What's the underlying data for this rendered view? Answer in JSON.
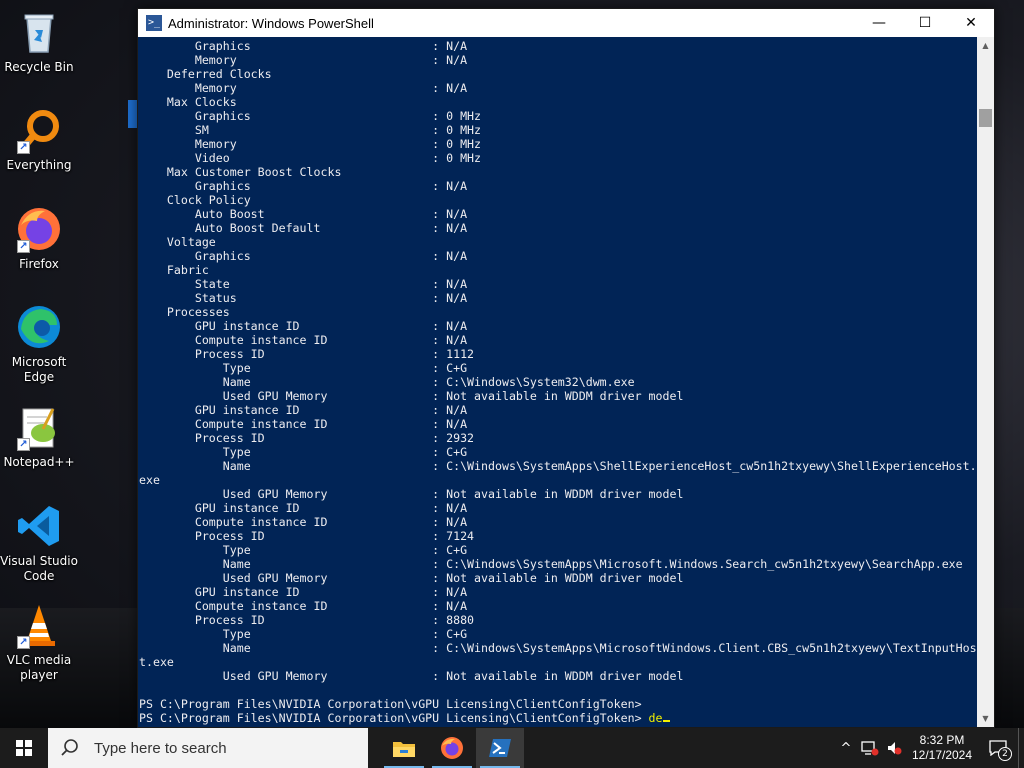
{
  "desktop": {
    "icons": [
      {
        "label": "Recycle Bin",
        "icon": "recycle-bin-icon"
      },
      {
        "label": "Everything",
        "icon": "everything-search-icon"
      },
      {
        "label": "Firefox",
        "icon": "firefox-icon"
      },
      {
        "label": "Microsoft Edge",
        "icon": "edge-icon"
      },
      {
        "label": "Notepad++",
        "icon": "notepadpp-icon"
      },
      {
        "label": "Visual Studio Code",
        "icon": "vscode-icon"
      },
      {
        "label": "VLC media player",
        "icon": "vlc-icon"
      }
    ]
  },
  "window": {
    "title": "Administrator: Windows PowerShell",
    "icon_glyph": ">_",
    "minimize": "—",
    "maximize": "☐",
    "close": "✕"
  },
  "console": {
    "lines": [
      "        Graphics                          : N/A",
      "        Memory                            : N/A",
      "    Deferred Clocks",
      "        Memory                            : N/A",
      "    Max Clocks",
      "        Graphics                          : 0 MHz",
      "        SM                                : 0 MHz",
      "        Memory                            : 0 MHz",
      "        Video                             : 0 MHz",
      "    Max Customer Boost Clocks",
      "        Graphics                          : N/A",
      "    Clock Policy",
      "        Auto Boost                        : N/A",
      "        Auto Boost Default                : N/A",
      "    Voltage",
      "        Graphics                          : N/A",
      "    Fabric",
      "        State                             : N/A",
      "        Status                            : N/A",
      "    Processes",
      "        GPU instance ID                   : N/A",
      "        Compute instance ID               : N/A",
      "        Process ID                        : 1112",
      "            Type                          : C+G",
      "            Name                          : C:\\Windows\\System32\\dwm.exe",
      "            Used GPU Memory               : Not available in WDDM driver model",
      "        GPU instance ID                   : N/A",
      "        Compute instance ID               : N/A",
      "        Process ID                        : 2932",
      "            Type                          : C+G",
      "            Name                          : C:\\Windows\\SystemApps\\ShellExperienceHost_cw5n1h2txyewy\\ShellExperienceHost.",
      "exe",
      "            Used GPU Memory               : Not available in WDDM driver model",
      "        GPU instance ID                   : N/A",
      "        Compute instance ID               : N/A",
      "        Process ID                        : 7124",
      "            Type                          : C+G",
      "            Name                          : C:\\Windows\\SystemApps\\Microsoft.Windows.Search_cw5n1h2txyewy\\SearchApp.exe",
      "            Used GPU Memory               : Not available in WDDM driver model",
      "        GPU instance ID                   : N/A",
      "        Compute instance ID               : N/A",
      "        Process ID                        : 8880",
      "            Type                          : C+G",
      "            Name                          : C:\\Windows\\SystemApps\\MicrosoftWindows.Client.CBS_cw5n1h2txyewy\\TextInputHos",
      "t.exe",
      "            Used GPU Memory               : Not available in WDDM driver model",
      "",
      "PS C:\\Program Files\\NVIDIA Corporation\\vGPU Licensing\\ClientConfigToken>"
    ],
    "prompt": "PS C:\\Program Files\\NVIDIA Corporation\\vGPU Licensing\\ClientConfigToken> ",
    "input": "de",
    "text_color": "#eeedf0",
    "background_color": "#012456",
    "input_color": "#f2f000"
  },
  "taskbar": {
    "search_placeholder": "Type here to search",
    "apps": [
      {
        "icon": "file-explorer-icon",
        "active": false
      },
      {
        "icon": "firefox-icon",
        "active": false
      },
      {
        "icon": "powershell-icon",
        "active": true
      }
    ],
    "tray": {
      "chevron": "^",
      "clock_time": "8:32 PM",
      "clock_date": "12/17/2024",
      "notification_count": "2"
    }
  }
}
